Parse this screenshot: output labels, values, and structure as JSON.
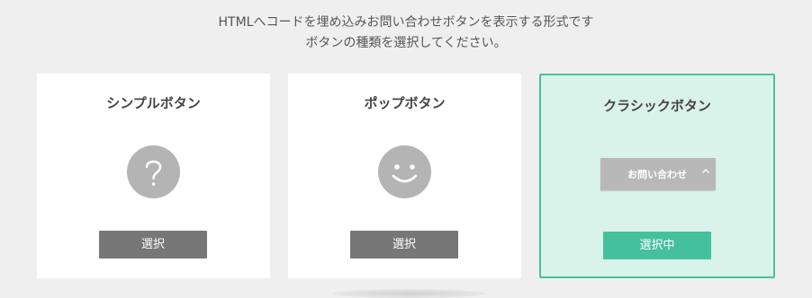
{
  "intro": {
    "line1": "HTMLへコードを埋め込みお問い合わせボタンを表示する形式です",
    "line2": "ボタンの種類を選択してください。"
  },
  "cards": [
    {
      "title": "シンプルボタン",
      "icon": "question-icon",
      "select_label": "選択"
    },
    {
      "title": "ポップボタン",
      "icon": "smiley-icon",
      "select_label": "選択"
    },
    {
      "title": "クラシックボタン",
      "preview_label": "お問い合わせ",
      "select_label": "選択中",
      "selected": true
    }
  ],
  "colors": {
    "background": "#efefef",
    "selected_border": "#4cc19d",
    "selected_bg": "#d9f2ea",
    "select_button": "#777777",
    "selected_button": "#45c09d",
    "icon_gray": "#b4b4b4"
  }
}
